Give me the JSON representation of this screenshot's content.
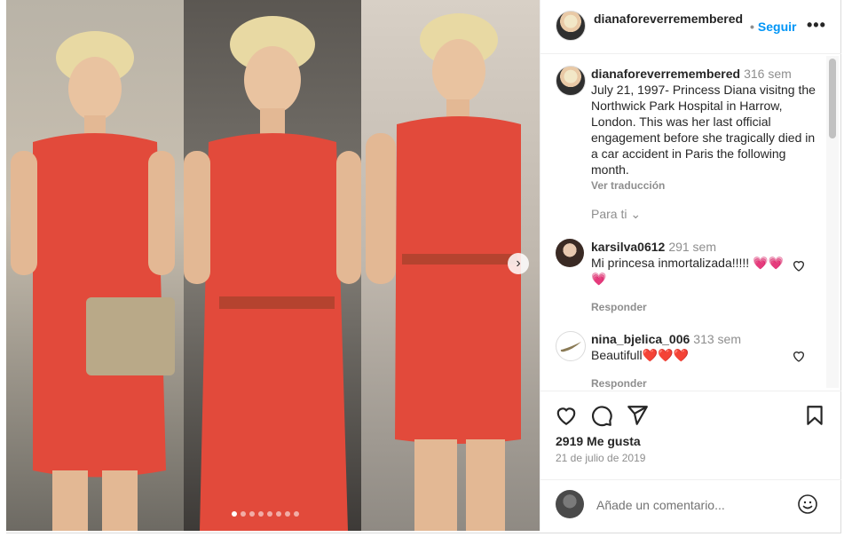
{
  "post": {
    "author": "dianaforeverremembered",
    "follow_label": "Seguir",
    "caption": {
      "time": "316 sem",
      "text": "July 21, 1997- Princess Diana visitng the Northwick Park Hospital in Harrow, London. This was her last official engagement before she tragically died in a car accident in Paris the following month.",
      "translate_label": "Ver traducción"
    },
    "filter_label": "Para ti",
    "comments": [
      {
        "username": "karsilva0612",
        "time": "291 sem",
        "text": "Mi princesa inmortalizada!!!!! 💗💗💗",
        "reply_label": "Responder"
      },
      {
        "username": "nina_bjelica_006",
        "time": "313 sem",
        "text": "Beautifull❤️❤️❤️",
        "reply_label": "Responder"
      }
    ],
    "likes": "2919 Me gusta",
    "date": "21 de julio de 2019",
    "comment_placeholder": "Añade un comentario...",
    "carousel": {
      "slide_count": 8,
      "active_slide": 1
    }
  },
  "colors": {
    "accent": "#0095f6",
    "muted": "#8e8e8e",
    "dress": "#e24a3b"
  },
  "icons": {
    "more": "more-options-icon",
    "like": "heart-icon",
    "comment": "comment-icon",
    "share": "share-icon",
    "save": "bookmark-icon",
    "emoji": "emoji-icon",
    "next": "chevron-right-icon"
  }
}
